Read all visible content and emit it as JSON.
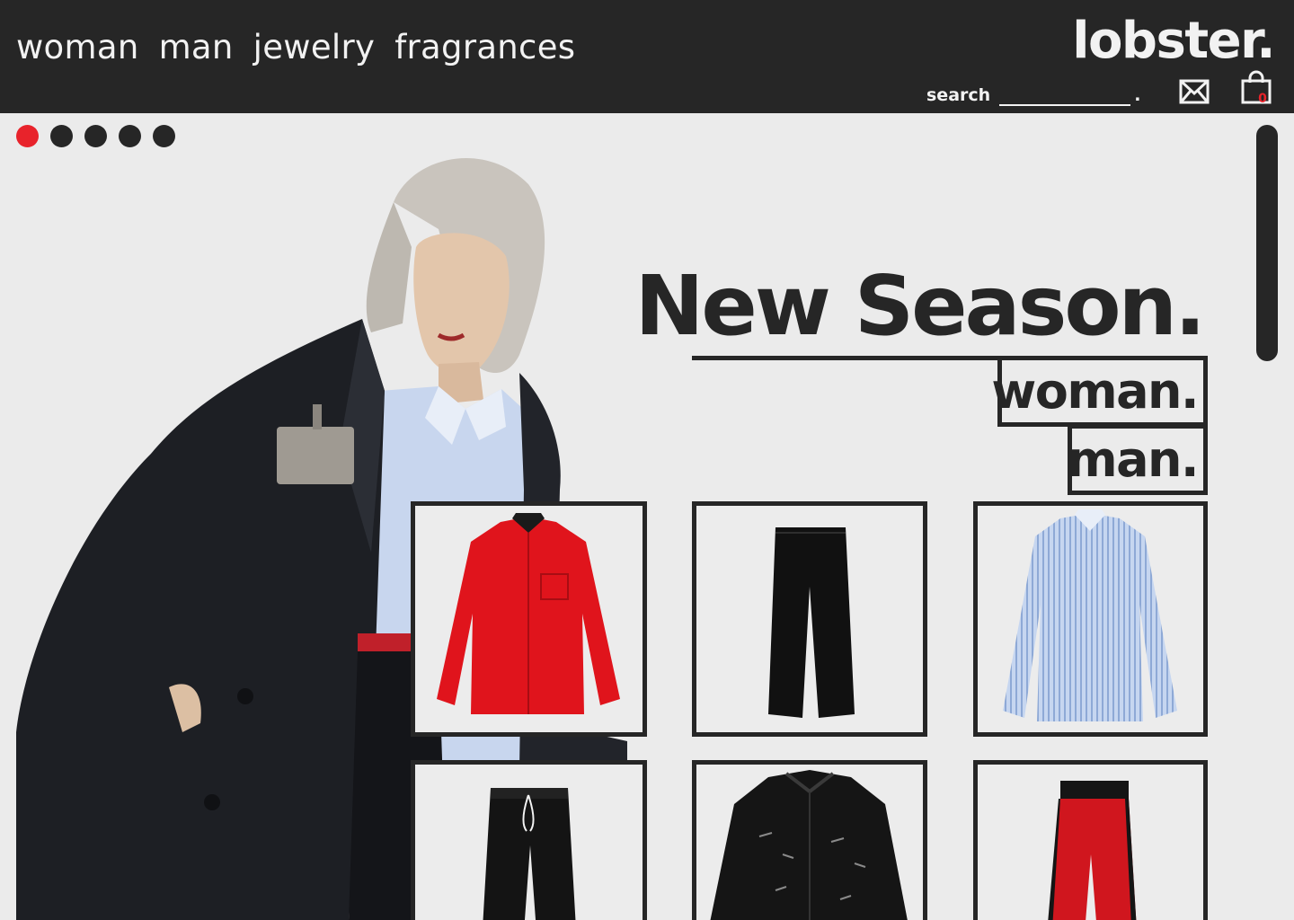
{
  "header": {
    "nav": [
      "woman",
      "man",
      "jewelry",
      "fragrances"
    ],
    "logo": "lobster.",
    "search_label": "search",
    "search_value": "",
    "search_suffix": ".",
    "icons": {
      "mail": "mail-icon",
      "bag": "shopping-bag-icon"
    },
    "cart_count": "0"
  },
  "carousel": {
    "total": 5,
    "active_index": 0
  },
  "hero": {
    "headline": "New Season.",
    "links": [
      "woman.",
      "man."
    ]
  },
  "products": [
    {
      "name": "red-shirt",
      "color": "#e0141c"
    },
    {
      "name": "black-trousers",
      "color": "#111111"
    },
    {
      "name": "blue-striped-shirt",
      "color": "#b9cbe8"
    },
    {
      "name": "black-drawstring-trousers",
      "color": "#141414"
    },
    {
      "name": "black-denim-jacket",
      "color": "#151515"
    },
    {
      "name": "red-track-pants",
      "color": "#d0161e"
    }
  ],
  "colors": {
    "dark": "#262626",
    "accent": "#e8232b",
    "background": "#ebebeb"
  }
}
